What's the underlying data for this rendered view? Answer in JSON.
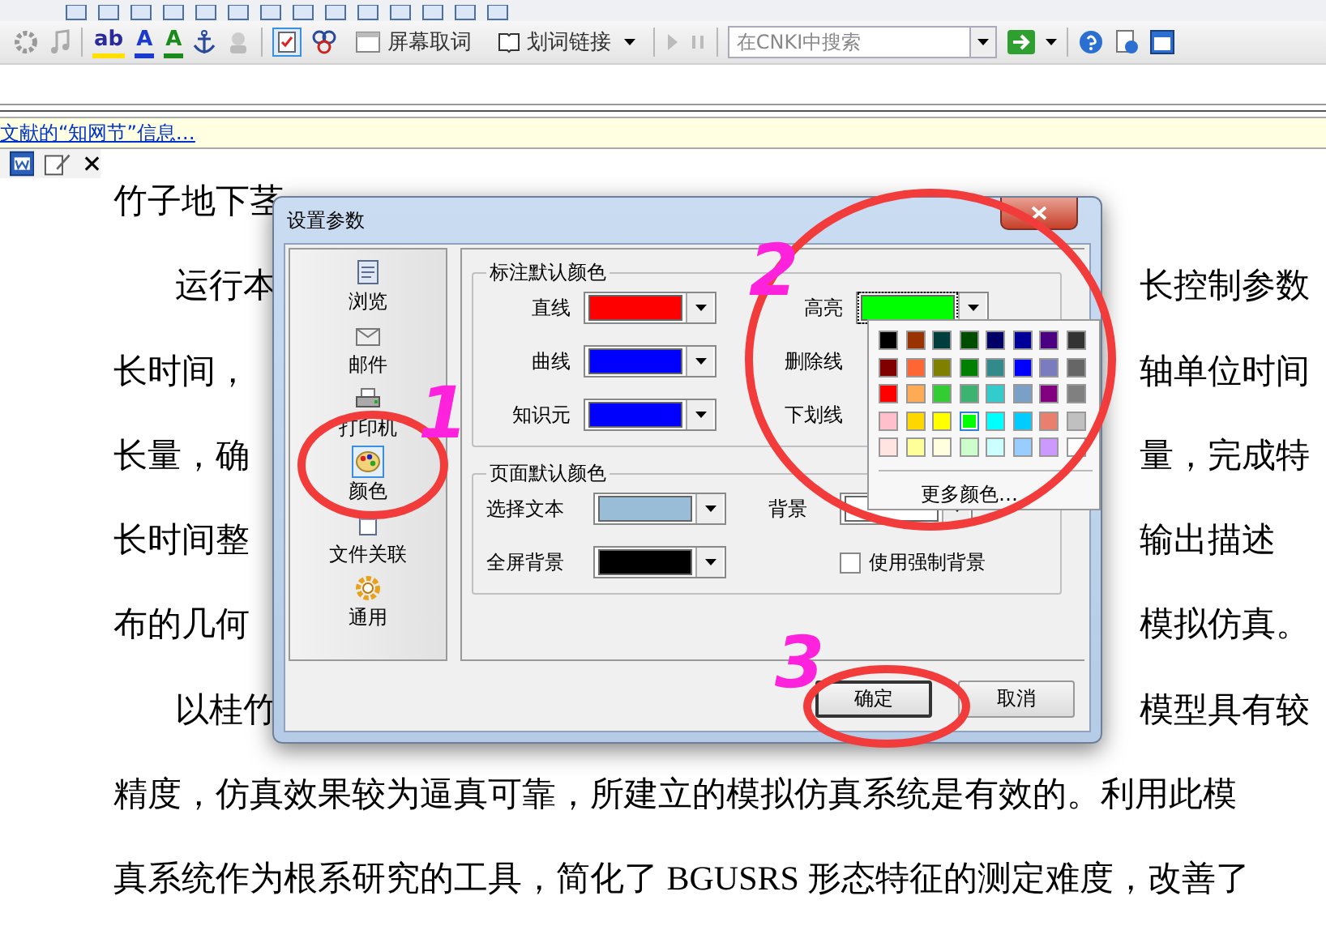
{
  "toolbar": {
    "format_buttons": [
      {
        "text": "ab",
        "color": "#2a2a9a"
      },
      {
        "text": "A",
        "color": "#1a3ad0"
      },
      {
        "text": "A",
        "color": "#1a8a1a"
      }
    ],
    "buttons": [
      {
        "label": "屏幕取词",
        "kind": "plain"
      },
      {
        "label": "划词链接",
        "kind": "menu"
      }
    ],
    "search": {
      "placeholder": "在CNKI中搜索"
    }
  },
  "info_bar": {
    "link": "文献的“知网节”信息…"
  },
  "document": {
    "lines": [
      {
        "kind": "plain",
        "left": "竹子地下茎"
      },
      {
        "kind": "indented",
        "left": "运行本",
        "right": "长控制参数"
      },
      {
        "kind": "plain",
        "left": "长时间，",
        "right": "轴单位时间"
      },
      {
        "kind": "plain",
        "left": "长量，确",
        "right": "量，完成特"
      },
      {
        "kind": "plain",
        "left": "长时间整",
        "right": "输出描述"
      },
      {
        "kind": "plain",
        "left": "布的几何",
        "right": "模拟仿真。"
      },
      {
        "kind": "indented",
        "left": "以桂竹",
        "right": "模型具有较"
      },
      {
        "kind": "plain",
        "left": "精度，仿真效果较为逼真可靠，所建立的模拟仿真系统是有效的。利用此模"
      },
      {
        "kind": "plain",
        "left": "真系统作为根系研究的工具，简化了 BGUSRS 形态特征的测定难度，改善了"
      }
    ]
  },
  "dialog": {
    "title": "设置参数",
    "categories": [
      {
        "label": "浏览",
        "kind": "browse",
        "selected": false
      },
      {
        "label": "邮件",
        "kind": "mail",
        "selected": false
      },
      {
        "label": "打印机",
        "kind": "printer",
        "selected": false
      },
      {
        "label": "颜色",
        "kind": "color",
        "selected": true
      },
      {
        "label": "文件关联",
        "kind": "file",
        "selected": false
      },
      {
        "label": "通用",
        "kind": "general",
        "selected": false
      }
    ],
    "groups": [
      {
        "title": "标注默认颜色",
        "columns": [
          {
            "fields": [
              {
                "kind": "color",
                "label": "直线",
                "color": "#ff0000",
                "expanded": false
              },
              {
                "kind": "color",
                "label": "曲线",
                "color": "#0000ff",
                "expanded": false
              },
              {
                "kind": "color",
                "label": "知识元",
                "color": "#0000ff",
                "expanded": false
              }
            ]
          },
          {
            "fields": [
              {
                "kind": "color",
                "label": "高亮",
                "color": "#00ff00",
                "expanded": true
              },
              {
                "kind": "label",
                "label": "删除线"
              },
              {
                "kind": "label",
                "label": "下划线"
              }
            ]
          }
        ]
      },
      {
        "title": "页面默认颜色",
        "columns": [
          {
            "fields": [
              {
                "kind": "color",
                "label": "选择文本",
                "color": "#99bdd6",
                "expanded": false
              },
              {
                "kind": "color",
                "label": "全屏背景",
                "color": "#000000",
                "expanded": false
              }
            ]
          },
          {
            "fields": [
              {
                "kind": "color",
                "label": "背景",
                "color": "#ffffff",
                "expanded": false
              },
              {
                "kind": "checkbox",
                "label": "使用强制背景",
                "checked": false
              }
            ]
          }
        ]
      }
    ],
    "palette": {
      "swatches": [
        {
          "color": "#000000",
          "selected": false
        },
        {
          "color": "#993300",
          "selected": false
        },
        {
          "color": "#003d3d",
          "selected": false
        },
        {
          "color": "#004d00",
          "selected": false
        },
        {
          "color": "#000066",
          "selected": false
        },
        {
          "color": "#000099",
          "selected": false
        },
        {
          "color": "#4b0082",
          "selected": false
        },
        {
          "color": "#333333",
          "selected": false
        },
        {
          "color": "#800000",
          "selected": false
        },
        {
          "color": "#ff6633",
          "selected": false
        },
        {
          "color": "#808000",
          "selected": false
        },
        {
          "color": "#008000",
          "selected": false
        },
        {
          "color": "#338a8a",
          "selected": false
        },
        {
          "color": "#0000ff",
          "selected": false
        },
        {
          "color": "#7b7bc0",
          "selected": false
        },
        {
          "color": "#666666",
          "selected": false
        },
        {
          "color": "#ff0000",
          "selected": false
        },
        {
          "color": "#ffaa55",
          "selected": false
        },
        {
          "color": "#33cc33",
          "selected": false
        },
        {
          "color": "#3cb371",
          "selected": false
        },
        {
          "color": "#33cccc",
          "selected": false
        },
        {
          "color": "#7ba0c8",
          "selected": false
        },
        {
          "color": "#800080",
          "selected": false
        },
        {
          "color": "#808080",
          "selected": false
        },
        {
          "color": "#ffc0cb",
          "selected": false
        },
        {
          "color": "#ffd700",
          "selected": false
        },
        {
          "color": "#ffff00",
          "selected": false
        },
        {
          "color": "#00ff00",
          "selected": true
        },
        {
          "color": "#00ffff",
          "selected": false
        },
        {
          "color": "#00ccff",
          "selected": false
        },
        {
          "color": "#e9806e",
          "selected": false
        },
        {
          "color": "#c0c0c0",
          "selected": false
        },
        {
          "color": "#ffe4e1",
          "selected": false
        },
        {
          "color": "#ffff99",
          "selected": false
        },
        {
          "color": "#ffffe0",
          "selected": false
        },
        {
          "color": "#ccffcc",
          "selected": false
        },
        {
          "color": "#ccffff",
          "selected": false
        },
        {
          "color": "#99ccff",
          "selected": false
        },
        {
          "color": "#cc99ff",
          "selected": false
        },
        {
          "color": "#ffffff",
          "selected": false
        }
      ],
      "more": "更多颜色…"
    },
    "buttons": [
      {
        "label": "确定",
        "default": true
      },
      {
        "label": "取消",
        "default": false
      }
    ]
  },
  "annotations": [
    {
      "label": "1"
    },
    {
      "label": "2"
    },
    {
      "label": "3"
    }
  ]
}
